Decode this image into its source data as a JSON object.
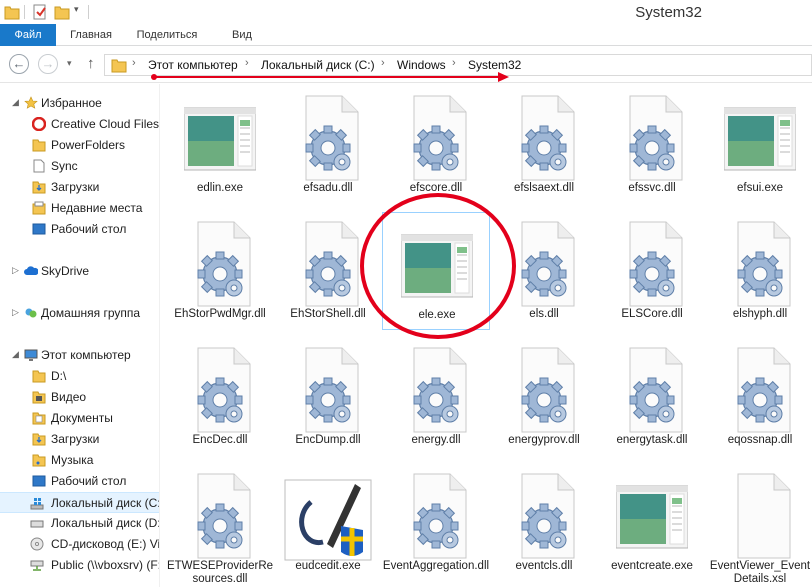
{
  "window": {
    "title": "System32"
  },
  "quick_access": {
    "save_icon": "properties-icon",
    "newfolder_icon": "new-folder-icon",
    "dropdown_icon": "chevron-down-icon"
  },
  "ribbon": {
    "tabs": [
      "Файл",
      "Главная",
      "Поделиться",
      "Вид"
    ]
  },
  "address": {
    "crumbs": [
      "Этот компьютер",
      "Локальный диск (C:)",
      "Windows",
      "System32"
    ]
  },
  "nav": {
    "favorites_header": "Избранное",
    "favorites": [
      "Creative Cloud Files",
      "PowerFolders",
      "Sync",
      "Загрузки",
      "Недавние места",
      "Рабочий стол"
    ],
    "skydrive": "SkyDrive",
    "homegroup": "Домашняя группа",
    "computer_header": "Этот компьютер",
    "computer_items": [
      "D:\\",
      "Видео",
      "Документы",
      "Загрузки",
      "Музыка",
      "Рабочий стол",
      "Локальный диск (C:)",
      "Локальный диск (D:)",
      "CD-дисковод (E:) Vi",
      "Public (\\\\vboxsrv) (F:)"
    ]
  },
  "files": [
    {
      "name": "edlin.exe",
      "kind": "app"
    },
    {
      "name": "efsadu.dll",
      "kind": "dll"
    },
    {
      "name": "efscore.dll",
      "kind": "dll"
    },
    {
      "name": "efslsaext.dll",
      "kind": "dll"
    },
    {
      "name": "efssvc.dll",
      "kind": "dll"
    },
    {
      "name": "efsui.exe",
      "kind": "app"
    },
    {
      "name": "EhStorPwdMgr.dll",
      "kind": "dll"
    },
    {
      "name": "EhStorShell.dll",
      "kind": "dll"
    },
    {
      "name": "ele.exe",
      "kind": "app",
      "selected": true
    },
    {
      "name": "els.dll",
      "kind": "dll"
    },
    {
      "name": "ELSCore.dll",
      "kind": "dll"
    },
    {
      "name": "elshyph.dll",
      "kind": "dll"
    },
    {
      "name": "EncDec.dll",
      "kind": "dll"
    },
    {
      "name": "EncDump.dll",
      "kind": "dll"
    },
    {
      "name": "energy.dll",
      "kind": "dll"
    },
    {
      "name": "energyprov.dll",
      "kind": "dll"
    },
    {
      "name": "energytask.dll",
      "kind": "dll"
    },
    {
      "name": "eqossnap.dll",
      "kind": "dll"
    },
    {
      "name": "ETWESEProviderResources.dll",
      "kind": "dll"
    },
    {
      "name": "eudcedit.exe",
      "kind": "eudc"
    },
    {
      "name": "EventAggregation.dll",
      "kind": "dll"
    },
    {
      "name": "eventcls.dll",
      "kind": "dll"
    },
    {
      "name": "eventcreate.exe",
      "kind": "app"
    },
    {
      "name": "EventViewer_EventDetails.xsl",
      "kind": "doc"
    }
  ],
  "annotation_colors": {
    "arrow": "#e3001b",
    "circle": "#e3001b"
  }
}
